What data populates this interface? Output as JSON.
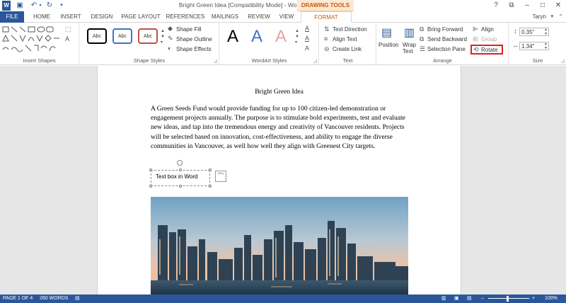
{
  "window": {
    "title": "Bright Green Idea [Compatibility Mode] - Word",
    "contextual_tab_group": "DRAWING TOOLS",
    "user": "Taryn"
  },
  "tabs": [
    "FILE",
    "HOME",
    "INSERT",
    "DESIGN",
    "PAGE LAYOUT",
    "REFERENCES",
    "MAILINGS",
    "REVIEW",
    "VIEW",
    "FORMAT"
  ],
  "ribbon": {
    "insert_shapes": {
      "label": "Insert Shapes"
    },
    "shape_styles": {
      "label": "Shape Styles",
      "gallery": [
        "Abc",
        "Abc",
        "Abc"
      ],
      "shape_fill": "Shape Fill",
      "shape_outline": "Shape Outline",
      "shape_effects": "Shape Effects",
      "gallery_colors": [
        "#000000",
        "#4472c4",
        "#c0504d"
      ]
    },
    "wordart_styles": {
      "label": "WordArt Styles",
      "letters": [
        "A",
        "A",
        "A"
      ],
      "letter_colors": [
        "#000000",
        "#4472c4",
        "#e7a3a3"
      ]
    },
    "text": {
      "label": "Text",
      "text_direction": "Text Direction",
      "align_text": "Align Text",
      "create_link": "Create Link"
    },
    "arrange": {
      "label": "Arrange",
      "position": "Position",
      "wrap_text_line1": "Wrap",
      "wrap_text_line2": "Text",
      "bring_forward": "Bring Forward",
      "send_backward": "Send Backward",
      "selection_pane": "Selection Pane",
      "align": "Align",
      "group": "Group",
      "rotate": "Rotate"
    },
    "size": {
      "label": "Size",
      "height": "0.35\"",
      "width": "1.34\""
    }
  },
  "document": {
    "heading": "Bright Green Idea",
    "body": "A Green Seeds Fund would provide funding for up to 100 citizen-led demonstration or engagement projects annually. The purpose is to stimulate bold experiments, test and evaluate new ideas, and tap into the tremendous energy and creativity of Vancouver residents. Projects will be selected based on innovation, cost-effectiveness, and ability to engage the diverse communities in Vancouver, as well how well they align with Greenest City targets.",
    "text_box": "Text box in Word"
  },
  "status_bar": {
    "page": "PAGE 1 OF 4",
    "words": "260 WORDS",
    "zoom": "100%"
  },
  "colors": {
    "accent": "#2b579a",
    "format_tab": "#c55a11",
    "highlight": "#e02020"
  }
}
